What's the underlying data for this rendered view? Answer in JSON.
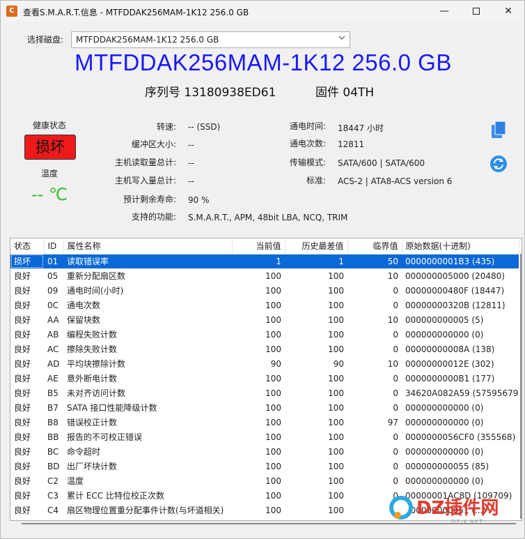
{
  "window": {
    "title": "查看S.M.A.R.T.信息 - MTFDDAK256MAM-1K12 256.0 GB",
    "app_icon_letter": "C",
    "minimize_glyph": "—",
    "close_glyph": "✕"
  },
  "disk_selector": {
    "label": "选择磁盘:",
    "selected": "MTFDDAK256MAM-1K12 256.0 GB"
  },
  "disk": {
    "model_title": "MTFDDAK256MAM-1K12 256.0 GB",
    "serial": "序列号 13180938ED61",
    "firmware": "固件 04TH"
  },
  "health": {
    "label": "健康状态",
    "status": "损坏",
    "status_color": "#ee1a1a",
    "temp_label": "温度",
    "temp_value": "-- ℃",
    "temp_color": "#2fbf2f"
  },
  "info_left": [
    {
      "label": "转速:",
      "value": "-- (SSD)"
    },
    {
      "label": "缓冲区大小:",
      "value": "--"
    },
    {
      "label": "主机读取量总计:",
      "value": "--"
    },
    {
      "label": "主机写入量总计:",
      "value": "--"
    },
    {
      "label": "预计剩余寿命:",
      "value": "90 %"
    },
    {
      "label": "支持的功能:",
      "value": "S.M.A.R.T., APM, 48bit LBA, NCQ, TRIM"
    }
  ],
  "info_right": [
    {
      "label": "通电时间:",
      "value": "18447 小时"
    },
    {
      "label": "通电次数:",
      "value": "12811"
    },
    {
      "label": "传输模式:",
      "value": "SATA/600 | SATA/600"
    },
    {
      "label": "标准:",
      "value": "ACS-2 | ATA8-ACS version 6"
    }
  ],
  "side_icons": [
    "copy-icon",
    "refresh-icon"
  ],
  "table": {
    "headers": [
      "状态",
      "ID",
      "属性名称",
      "当前值",
      "历史最差值",
      "临界值",
      "原始数据(十进制)"
    ],
    "rows": [
      [
        "损坏",
        "01",
        "读取错误率",
        "1",
        "1",
        "50",
        "0000000001B3 (435)"
      ],
      [
        "良好",
        "05",
        "重新分配扇区数",
        "100",
        "100",
        "10",
        "000000005000 (20480)"
      ],
      [
        "良好",
        "09",
        "通电时间(小时)",
        "100",
        "100",
        "0",
        "00000000480F (18447)"
      ],
      [
        "良好",
        "0C",
        "通电次数",
        "100",
        "100",
        "0",
        "00000000320B (12811)"
      ],
      [
        "良好",
        "AA",
        "保留块数",
        "100",
        "100",
        "10",
        "000000000005 (5)"
      ],
      [
        "良好",
        "AB",
        "编程失败计数",
        "100",
        "100",
        "0",
        "000000000000 (0)"
      ],
      [
        "良好",
        "AC",
        "擦除失败计数",
        "100",
        "100",
        "0",
        "00000000008A (138)"
      ],
      [
        "良好",
        "AD",
        "平均块擦除计数",
        "90",
        "90",
        "10",
        "00000000012E (302)"
      ],
      [
        "良好",
        "AE",
        "意外断电计数",
        "100",
        "100",
        "0",
        "0000000000B1 (177)"
      ],
      [
        "良好",
        "B5",
        "未对齐访问计数",
        "100",
        "100",
        "0",
        "34620A082A59 (57595679"
      ],
      [
        "良好",
        "B7",
        "SATA 接口性能降级计数",
        "100",
        "100",
        "0",
        "000000000000 (0)"
      ],
      [
        "良好",
        "B8",
        "错误校正计数",
        "100",
        "100",
        "97",
        "000000000000 (0)"
      ],
      [
        "良好",
        "BB",
        "报告的不可校正错误",
        "100",
        "100",
        "0",
        "0000000056CF0 (355568)"
      ],
      [
        "良好",
        "BC",
        "命令超时",
        "100",
        "100",
        "0",
        "000000000000 (0)"
      ],
      [
        "良好",
        "BD",
        "出厂坏块计数",
        "100",
        "100",
        "0",
        "000000000055 (85)"
      ],
      [
        "良好",
        "C2",
        "温度",
        "100",
        "100",
        "0",
        "000000000000 (0)"
      ],
      [
        "良好",
        "C3",
        "累计 ECC 比特位校正次数",
        "100",
        "100",
        "0",
        "00000001AC8D (109709)"
      ],
      [
        "良好",
        "C4",
        "扇区物理位置重分配事件计数(与坏道相关)",
        "100",
        "100",
        "0",
        "000000000051 (...)"
      ]
    ],
    "selected_row": 0,
    "selection_color": "#0a68d8"
  },
  "watermark": {
    "text": "DZ插件网",
    "sub": "DZ-X.NET"
  }
}
